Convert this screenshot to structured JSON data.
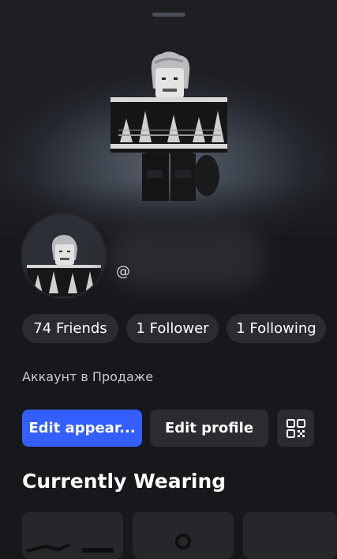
{
  "profile": {
    "username_prefix": "@",
    "status": "Аккаунт в Продаже"
  },
  "stats": {
    "friends_label": "74 Friends",
    "followers_label": "1 Follower",
    "following_label": "1 Following"
  },
  "actions": {
    "edit_appearance_label": "Edit appear...",
    "edit_profile_label": "Edit profile"
  },
  "icons": {
    "qr": "qr-code-icon",
    "drag": "drag-handle-icon"
  },
  "sections": {
    "currently_wearing_title": "Currently Wearing"
  },
  "colors": {
    "background": "#17181b",
    "surface": "#2a2c31",
    "primary": "#335fff"
  }
}
